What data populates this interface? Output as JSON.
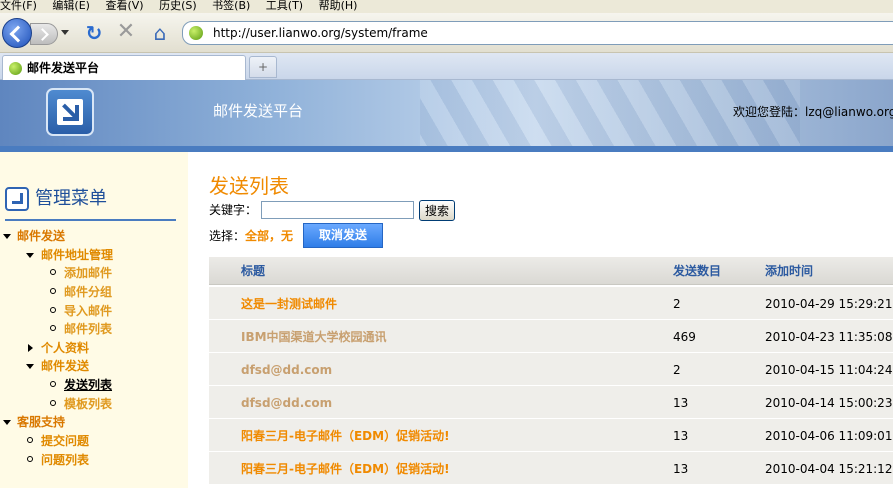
{
  "browser": {
    "menu": [
      "文件(F)",
      "编辑(E)",
      "查看(V)",
      "历史(S)",
      "书签(B)",
      "工具(T)",
      "帮助(H)"
    ],
    "url": "http://user.lianwo.org/system/frame",
    "tab_title": "邮件发送平台",
    "new_tab_symbol": "+"
  },
  "header": {
    "site_title": "邮件发送平台",
    "welcome": "欢迎您登陆：lzq@lianwo.org"
  },
  "sidebar": {
    "title": "管理菜单",
    "tree": [
      {
        "label": "邮件发送",
        "level": 0,
        "state": "expanded"
      },
      {
        "label": "邮件地址管理",
        "level": 1,
        "state": "expanded"
      },
      {
        "label": "添加邮件",
        "level": 2,
        "state": "leaf"
      },
      {
        "label": "邮件分组",
        "level": 2,
        "state": "leaf"
      },
      {
        "label": "导入邮件",
        "level": 2,
        "state": "leaf"
      },
      {
        "label": "邮件列表",
        "level": 2,
        "state": "leaf"
      },
      {
        "label": "个人资料",
        "level": 1,
        "state": "collapsed"
      },
      {
        "label": "邮件发送",
        "level": 1,
        "state": "expanded"
      },
      {
        "label": "发送列表",
        "level": 2,
        "state": "leaf",
        "current": true
      },
      {
        "label": "模板列表",
        "level": 2,
        "state": "leaf"
      },
      {
        "label": "客服支持",
        "level": 0,
        "state": "expanded"
      },
      {
        "label": "提交问题",
        "level": 1,
        "state": "leaf"
      },
      {
        "label": "问题列表",
        "level": 1,
        "state": "leaf"
      }
    ]
  },
  "main": {
    "page_title": "发送列表",
    "keyword_label": "关键字：",
    "keyword_value": "",
    "search_button": "搜索",
    "select_label": "选择：",
    "select_all": "全部",
    "select_sep": "，",
    "select_none": "无",
    "cancel_button": "取消发送",
    "columns": [
      "标题",
      "发送数目",
      "添加时间"
    ],
    "rows": [
      {
        "subject": "这是一封测试邮件",
        "count": "2",
        "time": "2010-04-29 15:29:21",
        "style": "unread"
      },
      {
        "subject": "IBM中国渠道大学校园通讯",
        "count": "469",
        "time": "2010-04-23 11:35:08",
        "style": "read"
      },
      {
        "subject": "dfsd@dd.com",
        "count": "2",
        "time": "2010-04-15 11:04:24",
        "style": "read"
      },
      {
        "subject": "dfsd@dd.com",
        "count": "13",
        "time": "2010-04-14 15:00:23",
        "style": "read"
      },
      {
        "subject": "阳春三月-电子邮件（EDM）促销活动!",
        "count": "13",
        "time": "2010-04-06 11:09:01",
        "style": "unread"
      },
      {
        "subject": "阳春三月-电子邮件（EDM）促销活动!",
        "count": "13",
        "time": "2010-04-04 15:21:12",
        "style": "unread"
      }
    ]
  },
  "colors": {
    "accent_orange": "#f08a00",
    "link_blue": "#2c5aa0",
    "header_blue": "#4a7cc0",
    "button_blue": "#2f7de8"
  }
}
